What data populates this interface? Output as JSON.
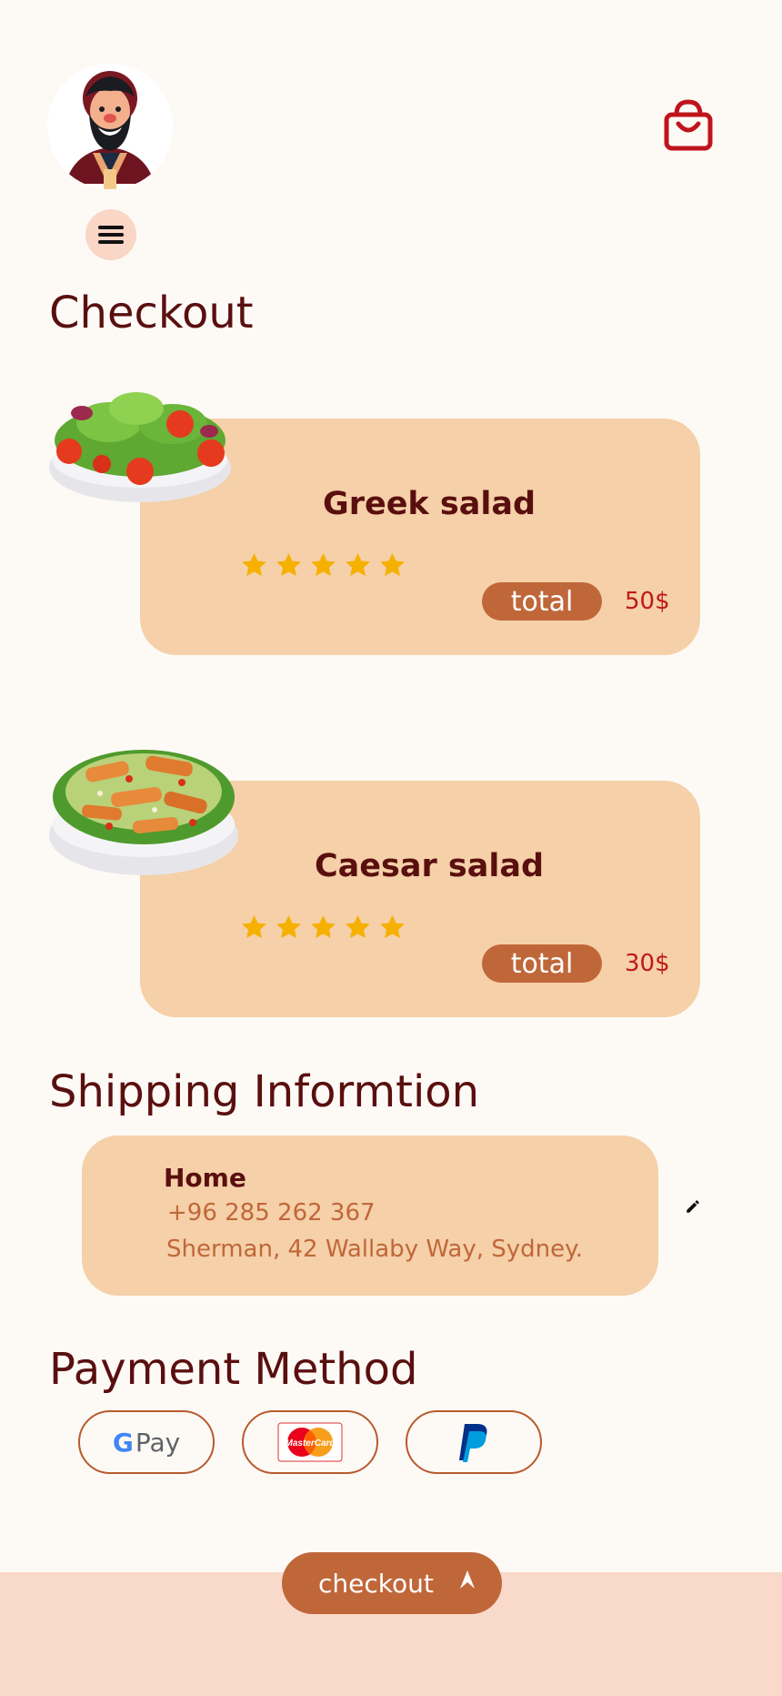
{
  "header": {
    "avatar_icon": "bearded-man-avatar",
    "menu_icon": "hamburger-menu-icon",
    "cart_icon": "shopping-bag-icon"
  },
  "checkout": {
    "title": "Checkout",
    "items": [
      {
        "name": "Greek salad",
        "rating": 5,
        "total_label": "total",
        "price": "50$",
        "image": "greek-salad-bowl"
      },
      {
        "name": "Caesar salad",
        "rating": 5,
        "total_label": "total",
        "price": "30$",
        "image": "caesar-salad-bowl"
      }
    ]
  },
  "shipping": {
    "title": "Shipping Informtion",
    "label": "Home",
    "phone": "+96 285 262 367",
    "address": "Sherman, 42 Wallaby Way, Sydney.",
    "edit_icon": "pencil-icon"
  },
  "payment": {
    "title": "Payment Method",
    "methods": [
      {
        "name": "G Pay",
        "letter": "G",
        "word": "Pay",
        "icon": "google-pay-logo"
      },
      {
        "name": "MasterCard",
        "icon": "mastercard-logo"
      },
      {
        "name": "PayPal",
        "icon": "paypal-logo"
      }
    ]
  },
  "footer": {
    "checkout_label": "checkout",
    "checkout_icon": "caret-up-icon"
  },
  "colors": {
    "background": "#fdfaf6",
    "accent": "#c0673a",
    "card": "#f5d0a8",
    "title": "#5a0f0f",
    "price": "#c01818",
    "star": "#f6b000",
    "bottom_bar": "#f9d9c9"
  }
}
